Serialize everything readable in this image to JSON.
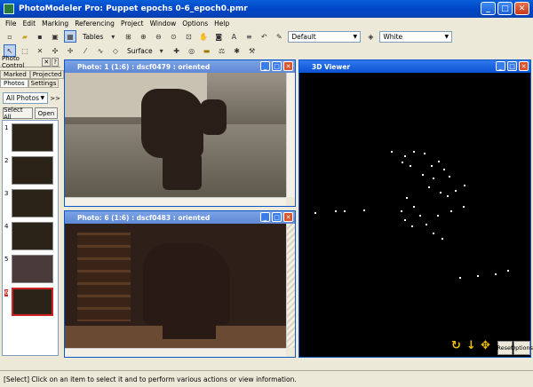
{
  "window": {
    "title": "PhotoModeler Pro: Puppet epochs 0-6_epoch0.pmr"
  },
  "menu": [
    "File",
    "Edit",
    "Marking",
    "Referencing",
    "Project",
    "Window",
    "Options",
    "Help"
  ],
  "toolbar": {
    "tables_label": "Tables",
    "surface_label": "Surface",
    "style_value": "Default",
    "color_value": "White"
  },
  "photo_control": {
    "title": "Photo Control",
    "help": "?",
    "tabs": [
      "Marked",
      "Projected",
      "Photos",
      "Settings"
    ],
    "filter_value": "All Photos",
    "more": ">>",
    "select_all": "Select All",
    "open": "Open",
    "thumbs": [
      "1",
      "2",
      "3",
      "4",
      "5",
      "6"
    ]
  },
  "photo1": {
    "title": "Photo: 1 (1:6) : dscf0479 : oriented"
  },
  "photo6": {
    "title": "Photo: 6 (1:6) : dscf0483 : oriented"
  },
  "viewer3d": {
    "title": "3D Viewer",
    "reset": "Reset",
    "options": "Options"
  },
  "status": {
    "text": "[Select] Click on an item to select it and to perform various actions or view information."
  }
}
